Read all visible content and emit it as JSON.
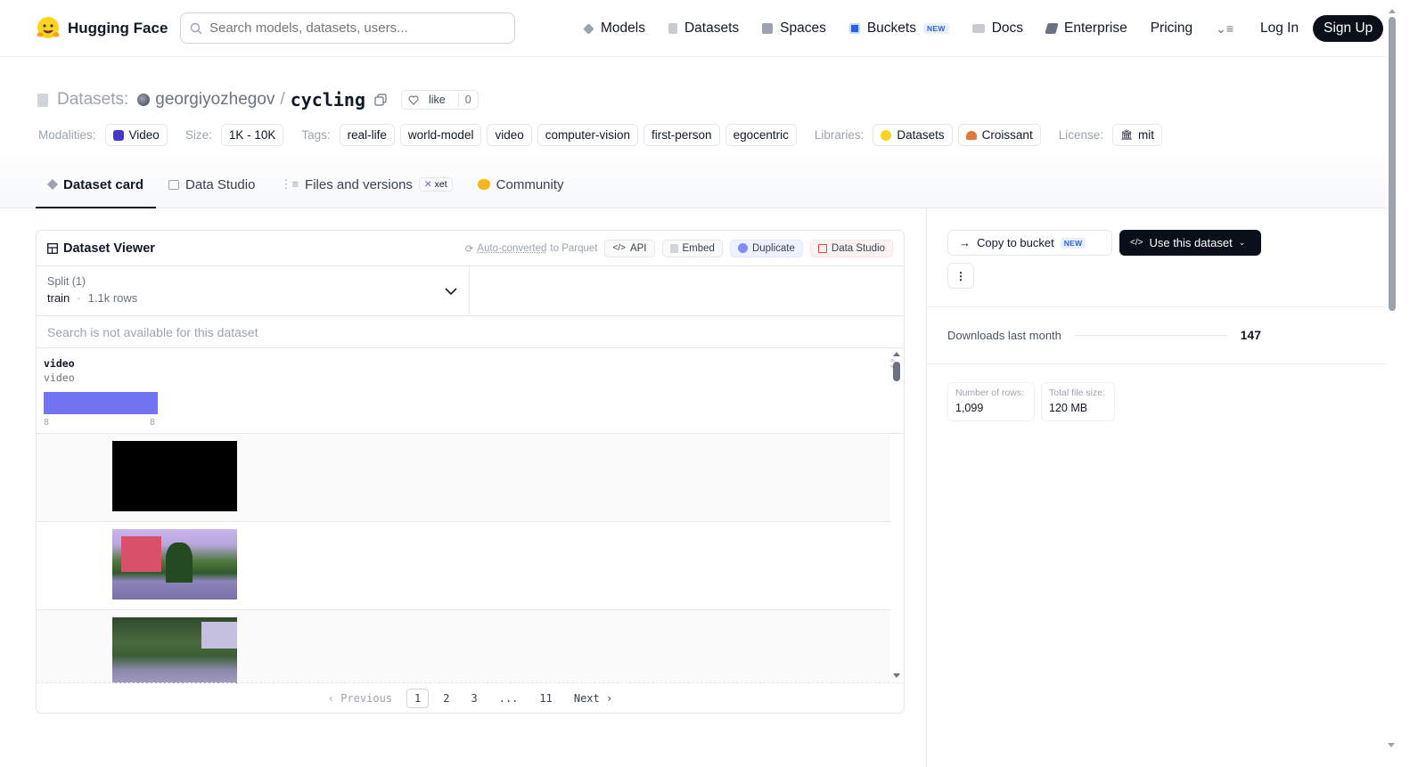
{
  "header": {
    "brand": "Hugging Face",
    "search_placeholder": "Search models, datasets, users...",
    "nav": [
      {
        "label": "Models",
        "icon": "cube-icon",
        "color": "#9ca3af"
      },
      {
        "label": "Datasets",
        "icon": "database-icon",
        "color": "#9ca3af"
      },
      {
        "label": "Spaces",
        "icon": "grid-icon",
        "color": "#9ca3af"
      },
      {
        "label": "Buckets",
        "icon": "bucket-icon",
        "color": "#2563eb",
        "badge": "NEW"
      },
      {
        "label": "Docs",
        "icon": "book-icon",
        "color": "#9ca3af"
      },
      {
        "label": "Enterprise",
        "icon": "enterprise-icon",
        "color": "#6b7280"
      },
      {
        "label": "Pricing"
      }
    ],
    "login": "Log In",
    "signup": "Sign Up"
  },
  "dataset": {
    "prefix": "Datasets:",
    "owner": "georgiyozhegov",
    "separator": "/",
    "name": "cycling",
    "like_label": "like",
    "like_count": "0",
    "meta": {
      "modalities_label": "Modalities:",
      "modality": "Video",
      "size_label": "Size:",
      "size": "1K - 10K",
      "tags_label": "Tags:",
      "tags": [
        "real-life",
        "world-model",
        "video",
        "computer-vision",
        "first-person",
        "egocentric"
      ],
      "libraries_label": "Libraries:",
      "libraries": [
        "Datasets",
        "Croissant"
      ],
      "license_label": "License:",
      "license": "mit"
    },
    "tabs": [
      {
        "label": "Dataset card",
        "active": true
      },
      {
        "label": "Data Studio"
      },
      {
        "label": "Files and versions",
        "badge": "xet"
      },
      {
        "label": "Community"
      }
    ]
  },
  "viewer": {
    "title": "Dataset Viewer",
    "auto_converted_prefix": "Auto-converted",
    "auto_converted_suffix": "to Parquet",
    "actions": [
      "API",
      "Embed",
      "Duplicate",
      "Data Studio"
    ],
    "split_label": "Split (1)",
    "split_name": "train",
    "split_rows": "1.1k rows",
    "search_disabled": "Search is not available for this dataset",
    "column": {
      "name": "video",
      "type": "video",
      "hist_min": "8",
      "hist_max": "8"
    },
    "pagination": {
      "previous": "Previous",
      "pages": [
        "1",
        "2",
        "3",
        "...",
        "11"
      ],
      "current": "1",
      "next": "Next"
    }
  },
  "sidebar": {
    "copy_to_bucket": "Copy to bucket",
    "copy_badge": "NEW",
    "use_dataset": "Use this dataset",
    "downloads_label": "Downloads last month",
    "downloads_value": "147",
    "rows_label": "Number of rows:",
    "rows_value": "1,099",
    "filesize_label": "Total file size:",
    "filesize_value": "120 MB"
  }
}
